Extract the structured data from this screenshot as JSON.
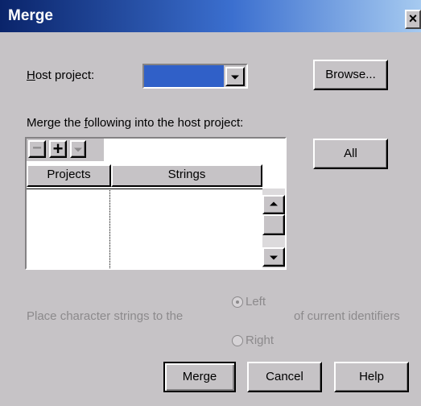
{
  "dialog": {
    "title": "Merge",
    "close_glyph": "×",
    "host_project": {
      "label_accel": "H",
      "label_rest": "ost project:",
      "value": "",
      "browse_label": "Browse..."
    },
    "merge_following": {
      "label_pre": "Merge the ",
      "label_accel": "f",
      "label_post": "ollowing  into the host project:",
      "all_label": "All"
    },
    "toolbar": {
      "remove_glyph": "−",
      "add_glyph": "+",
      "remove_icon": "minus-icon",
      "add_icon": "plus-icon",
      "dropdown_icon": "chevron-down-icon"
    },
    "grid": {
      "columns": [
        "Projects",
        "Strings"
      ],
      "rows": []
    },
    "placement": {
      "prefix": "Place character strings to the",
      "suffix": "of current identifiers",
      "options": [
        {
          "label": "Left",
          "selected": true
        },
        {
          "label": "Right",
          "selected": false
        }
      ]
    },
    "buttons": {
      "merge": "Merge",
      "cancel": "Cancel",
      "help": "Help"
    }
  },
  "colors": {
    "title_bar_start": "#0a246a",
    "title_bar_end": "#a6caf0",
    "dialog_face": "#c6c3c6",
    "combo_selection": "#3060c8",
    "disabled_text": "#8c8a8c"
  }
}
